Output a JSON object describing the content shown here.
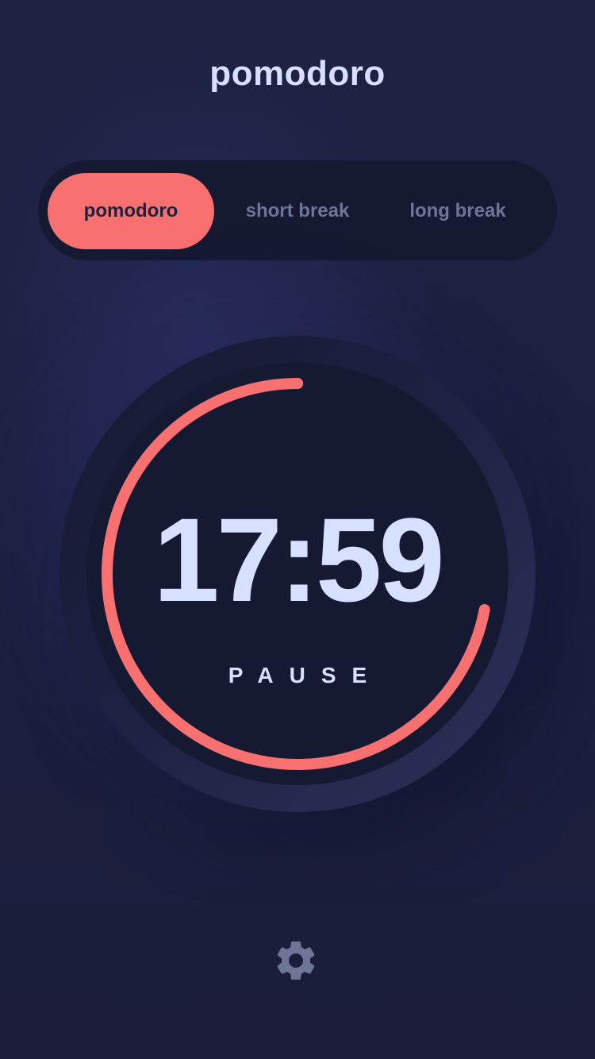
{
  "app": {
    "title": "pomodoro"
  },
  "modes": {
    "items": [
      {
        "label": "pomodoro",
        "active": true
      },
      {
        "label": "short break",
        "active": false
      },
      {
        "label": "long break",
        "active": false
      }
    ]
  },
  "timer": {
    "time": "17:59",
    "control_label": "PAUSE",
    "progress_fraction": 0.72
  },
  "settings": {
    "icon": "gear-icon"
  },
  "colors": {
    "accent": "#f87070",
    "background": "#1e2140",
    "panel": "#161932",
    "text": "#d7e0ff",
    "muted": "#6f7597"
  }
}
